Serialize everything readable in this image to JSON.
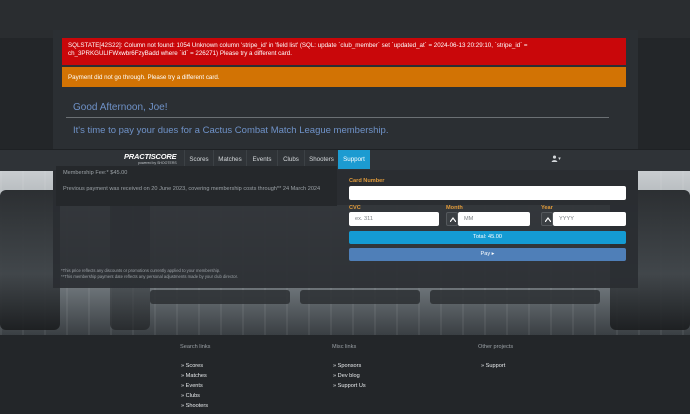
{
  "alerts": {
    "sql_error": "SQLSTATE[42S22]: Column not found: 1054 Unknown column 'stripe_id' in 'field list' (SQL: update `club_member` set `updated_at` = 2024-06-13 20:29:10, `stripe_id` = ch_3PRKGULIFWxwbr6FzyBadd where `id` = 226271) Please try a different card.",
    "payment_failed": "Payment did not go through. Please try a different card."
  },
  "greeting": "Good Afternoon, Joe!",
  "dues_text": "It's time to pay your dues for a Cactus Combat Match League membership.",
  "logo": {
    "main": "PRACTISCORE",
    "sub": "powered by SHOOTERS"
  },
  "nav": {
    "items": [
      "Scores",
      "Matches",
      "Events",
      "Clubs",
      "Shooters",
      "Support"
    ],
    "active": "Support"
  },
  "user_menu": "▾",
  "membership": {
    "fee": "Membership Fee:* $45.00",
    "previous_payment": "Previous payment was received on 20 June 2023, covering membership costs through** 24 March 2024",
    "note_discount": "*This price reflects any discounts or promotions currently applied to your membership.",
    "note_date": "**This membership payment date reflects any personal adjustments made by your club director."
  },
  "payment_form": {
    "card_number_label": "Card Number",
    "cvc_label": "CVC",
    "cvc_placeholder": "ex. 311",
    "month_label": "Month",
    "month_placeholder": "MM",
    "year_label": "Year",
    "year_placeholder": "YYYY",
    "total_label": "Total: 45.00",
    "pay_label": "Pay ▸"
  },
  "footer": {
    "search_links": {
      "title": "Search links",
      "links": [
        "Scores",
        "Matches",
        "Events",
        "Clubs",
        "Shooters"
      ]
    },
    "misc_links": {
      "title": "Misc links",
      "links": [
        "Sponsors",
        "Dev blog",
        "Support Us"
      ]
    },
    "other_projects": {
      "title": "Other projects",
      "links": [
        "Support"
      ]
    }
  },
  "colors": {
    "accent": "#1c9bd1",
    "error": "#c9070a",
    "warning": "#d27304",
    "label": "#e09a3a",
    "pay_button": "#4f7fb8"
  }
}
